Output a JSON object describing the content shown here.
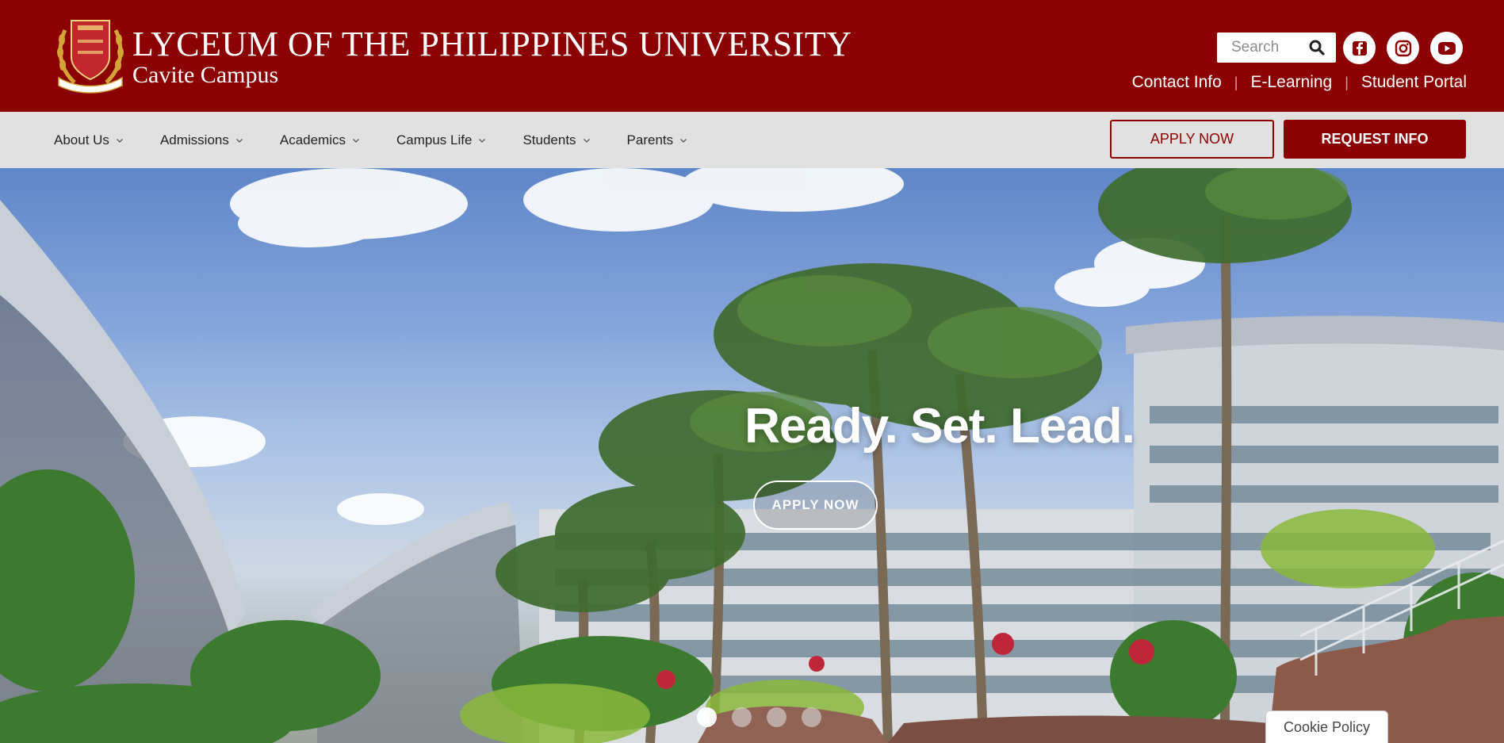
{
  "header": {
    "title": "LYCEUM OF THE PHILIPPINES UNIVERSITY",
    "subtitle": "Cavite Campus",
    "search": {
      "placeholder": "Search"
    },
    "social": [
      {
        "name": "facebook-icon"
      },
      {
        "name": "instagram-icon"
      },
      {
        "name": "youtube-icon"
      }
    ],
    "links": [
      "Contact Info",
      "E-Learning",
      "Student Portal"
    ]
  },
  "nav": {
    "items": [
      "About Us",
      "Admissions",
      "Academics",
      "Campus Life",
      "Students",
      "Parents"
    ],
    "apply_label": "APPLY NOW",
    "request_label": "REQUEST INFO"
  },
  "hero": {
    "headline": "Ready. Set. Lead.",
    "button_label": "APPLY NOW",
    "slide_count": 4,
    "active_slide": 1
  },
  "cookie": {
    "label": "Cookie Policy"
  },
  "colors": {
    "brand": "#8b0000",
    "navbar": "#e1e1e1"
  }
}
